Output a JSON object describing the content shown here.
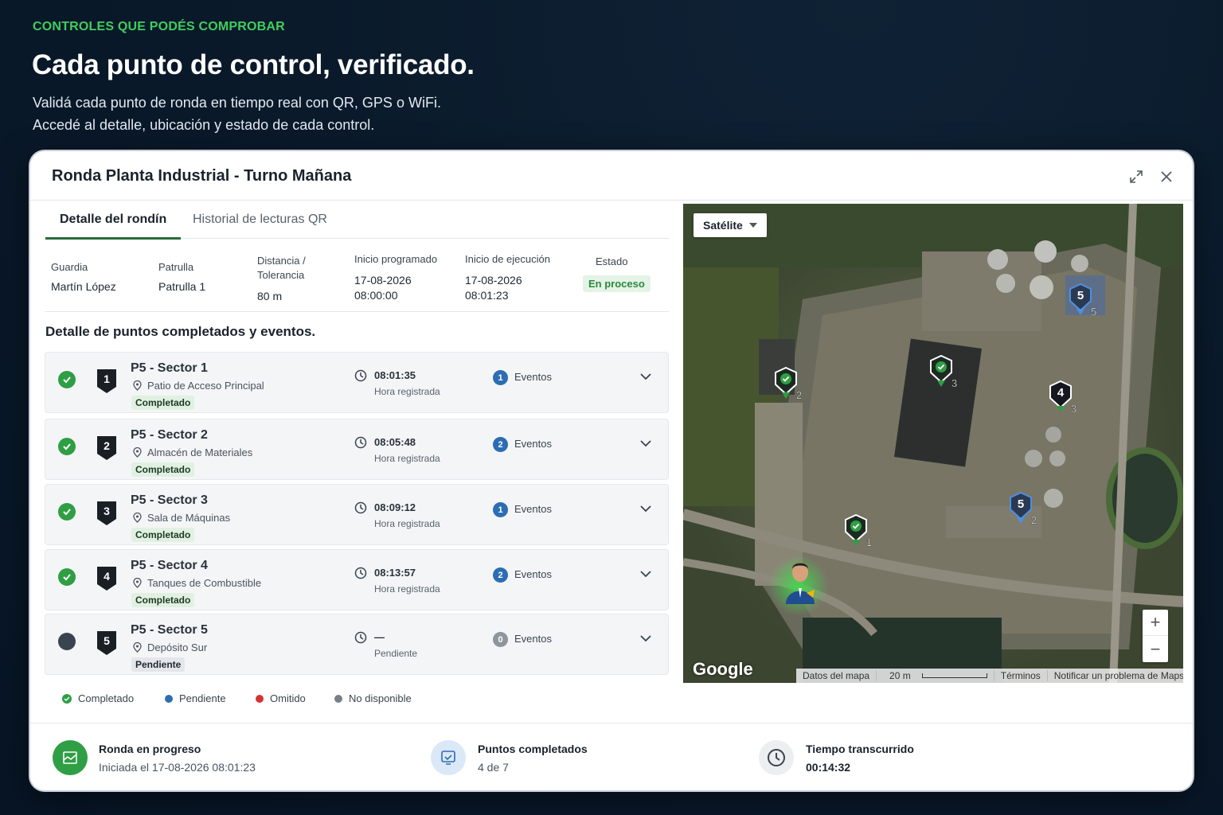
{
  "hero": {
    "eyebrow": "CONTROLES QUE PODÉS COMPROBAR",
    "title": "Cada punto de control, verificado.",
    "subtitle_line1": "Validá cada punto de ronda en tiempo real con QR, GPS o WiFi.",
    "subtitle_line2": "Accedé al detalle, ubicación y estado de cada control."
  },
  "window": {
    "title": "Ronda Planta Industrial - Turno Mañana",
    "expand_icon": "expand-icon",
    "close_icon": "close-icon"
  },
  "tabs": [
    {
      "label": "Detalle del rondín",
      "active": true
    },
    {
      "label": "Historial de lecturas QR",
      "active": false
    }
  ],
  "info": {
    "guard_label": "Guardia",
    "guard_value": "Martín López",
    "patrol_label": "Patrulla",
    "patrol_value": "Patrulla 1",
    "distance_label_1": "Distancia /",
    "distance_label_2": "Tolerancia",
    "distance_value": "80 m",
    "scheduled_label": "Inicio programado",
    "scheduled_date": "17-08-2026",
    "scheduled_time": "08:00:00",
    "exec_label": "Inicio de ejecución",
    "exec_date": "17-08-2026",
    "exec_time": "08:01:23",
    "status_label": "Estado",
    "status_value": "En proceso",
    "status_color": "#2b8a3e"
  },
  "section_title": "Detalle de puntos completados y eventos.",
  "points": [
    {
      "num": "1",
      "title": "P5 - Sector 1",
      "location": "Patio de Acceso Principal",
      "badge": "Completado",
      "time": "08:01:35",
      "time_label": "Hora registrada",
      "events": "1",
      "events_label": "Eventos",
      "status": "done"
    },
    {
      "num": "2",
      "title": "P5 - Sector 2",
      "location": "Almacén de Materiales",
      "badge": "Completado",
      "time": "08:05:48",
      "time_label": "Hora registrada",
      "events": "2",
      "events_label": "Eventos",
      "status": "done"
    },
    {
      "num": "3",
      "title": "P5 - Sector 3",
      "location": "Sala de Máquinas",
      "badge": "Completado",
      "time": "08:09:12",
      "time_label": "Hora registrada",
      "events": "1",
      "events_label": "Eventos",
      "status": "done"
    },
    {
      "num": "4",
      "title": "P5 - Sector 4",
      "location": "Tanques de Combustible",
      "badge": "Completado",
      "time": "08:13:57",
      "time_label": "Hora registrada",
      "events": "2",
      "events_label": "Eventos",
      "status": "done"
    },
    {
      "num": "5",
      "title": "P5 - Sector 5",
      "location": "Depósito Sur",
      "badge": "Pendiente",
      "time": "—",
      "time_label": "Pendiente",
      "events": "0",
      "events_label": "Eventos",
      "status": "pending"
    }
  ],
  "legend": [
    {
      "label": "Completado",
      "color": "#2f9e44"
    },
    {
      "label": "Pendiente",
      "color": "#2c6db3"
    },
    {
      "label": "Omitido",
      "color": "#d63333"
    },
    {
      "label": "No disponible",
      "color": "#777f88"
    }
  ],
  "map": {
    "type_label": "Satélite",
    "zoom_in": "+",
    "zoom_out": "−",
    "logo": "Google",
    "attrib_data": "Datos del mapa",
    "attrib_scale": "20 m",
    "attrib_terms": "Términos",
    "attrib_report": "Notificar un problema de Maps",
    "markers": [
      {
        "label": "5",
        "sub": "5",
        "state": "pending"
      },
      {
        "label": "",
        "sub": "2",
        "state": "done"
      },
      {
        "label": "",
        "sub": "3",
        "state": "done"
      },
      {
        "label": "4",
        "sub": "3",
        "state": "dark"
      },
      {
        "label": "5",
        "sub": "2",
        "state": "pending"
      },
      {
        "label": "",
        "sub": "1",
        "state": "done"
      }
    ]
  },
  "footer": {
    "progress_title": "Ronda en progreso",
    "progress_sub": "Iniciada el 17-08-2026 08:01:23",
    "points_title": "Puntos completados",
    "points_sub": "4 de 7",
    "time_title": "Tiempo transcurrido",
    "time_sub": "00:14:32"
  }
}
